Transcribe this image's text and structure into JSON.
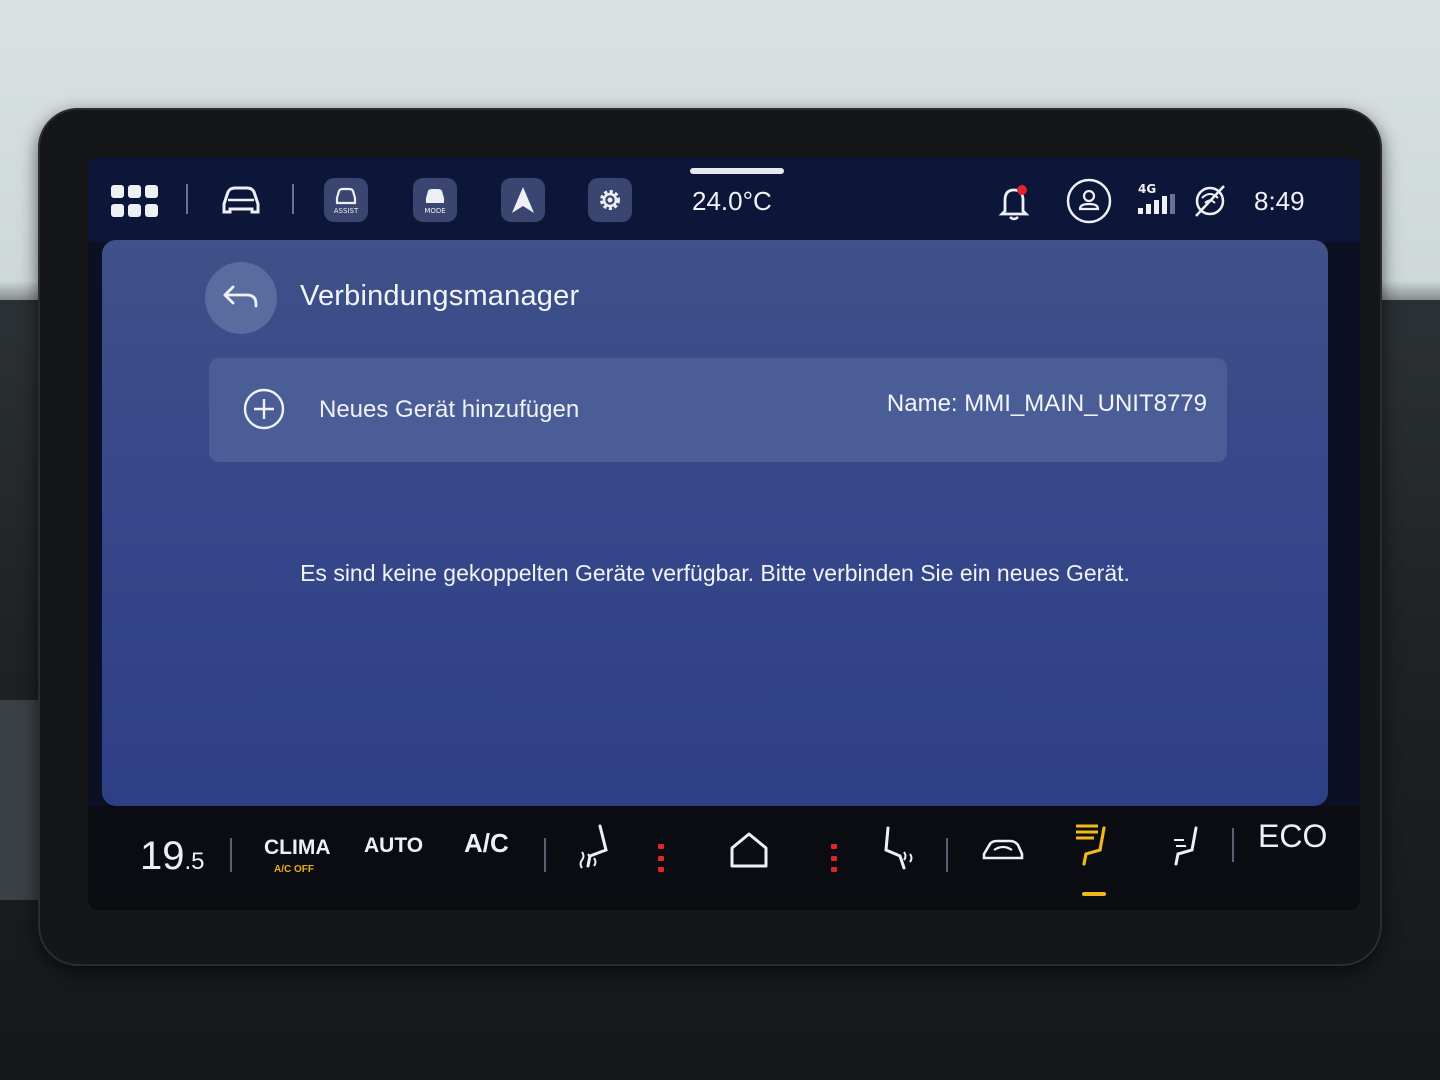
{
  "status_bar": {
    "temperature": "24.0°C",
    "clock": "8:49",
    "network": "4G",
    "assist_label": "ASSIST",
    "mode_label": "MODE"
  },
  "page": {
    "title": "Verbindungsmanager",
    "add_device_label": "Neues Gerät hinzufügen",
    "device_name": "Name: MMI_MAIN_UNIT8779",
    "empty_message": "Es sind keine gekoppelten Geräte verfügbar. Bitte verbinden Sie ein neues Gerät."
  },
  "climate_bar": {
    "temperature_main": "19",
    "temperature_decimal": ".5",
    "clima_label": "CLIMA",
    "clima_sub": "A/C OFF",
    "auto_label": "AUTO",
    "ac_label": "A/C",
    "eco_label": "ECO"
  },
  "colors": {
    "panel": "#36478a",
    "status_bar": "#0c1638",
    "accent_yellow": "#f0b81c",
    "heat_red": "#e0242d"
  }
}
